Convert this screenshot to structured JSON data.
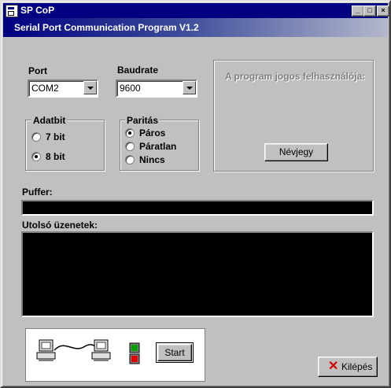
{
  "window": {
    "title": "SP CoP",
    "controls": {
      "minimize": "_",
      "maximize": "□",
      "close": "×"
    }
  },
  "header": {
    "text": "Serial Port Communication Program V1.2"
  },
  "port": {
    "label": "Port",
    "value": "COM2"
  },
  "baudrate": {
    "label": "Baudrate",
    "value": "9600"
  },
  "owner_panel": {
    "label": "A program jogos felhasználója:",
    "button": "Névjegy"
  },
  "databits": {
    "legend": "Adatbit",
    "options": [
      {
        "label": "7 bit",
        "selected": false
      },
      {
        "label": "8 bit",
        "selected": true
      }
    ]
  },
  "parity": {
    "legend": "Paritás",
    "options": [
      {
        "label": "Páros",
        "selected": true
      },
      {
        "label": "Páratlan",
        "selected": false
      },
      {
        "label": "Nincs",
        "selected": false
      }
    ]
  },
  "buffer": {
    "label": "Puffer:"
  },
  "messages": {
    "label": "Utolsó üzenetek:"
  },
  "status": {
    "icons": [
      "computer-icon",
      "cable-icon",
      "computer-icon"
    ],
    "start_button": "Start",
    "led_colors": {
      "top": "#00a000",
      "bottom": "#e00000"
    }
  },
  "exit_button": {
    "label": "Kilépés"
  }
}
